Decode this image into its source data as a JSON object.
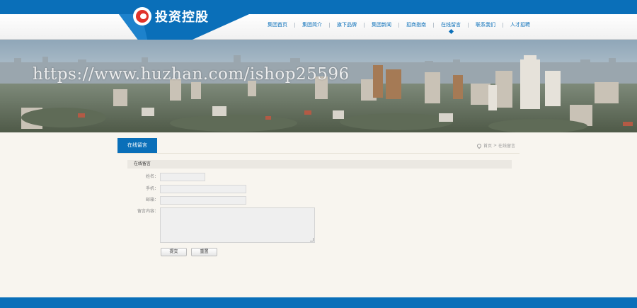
{
  "brand": {
    "logo_text": "投资控股",
    "accent": "#0a6fb9",
    "logo_red": "#e0332b"
  },
  "nav": {
    "items": [
      {
        "label": "集团首页"
      },
      {
        "label": "集团简介"
      },
      {
        "label": "旗下品牌"
      },
      {
        "label": "集团新闻"
      },
      {
        "label": "招商指南"
      },
      {
        "label": "在线留言",
        "active": true
      },
      {
        "label": "联系我们"
      },
      {
        "label": "人才招聘"
      }
    ]
  },
  "banner": {
    "watermark": "https://www.huzhan.com/ishop25596"
  },
  "breadcrumb": {
    "tab_label": "在线留言",
    "home": "首页",
    "separator": ">",
    "current": "在线留言",
    "icon": "location-pin-icon"
  },
  "form": {
    "section_title": "在线留言",
    "name_label": "姓名：",
    "phone_label": "手机：",
    "email_label": "邮箱：",
    "message_label": "留言内容：",
    "submit_label": "提交",
    "reset_label": "重置"
  }
}
